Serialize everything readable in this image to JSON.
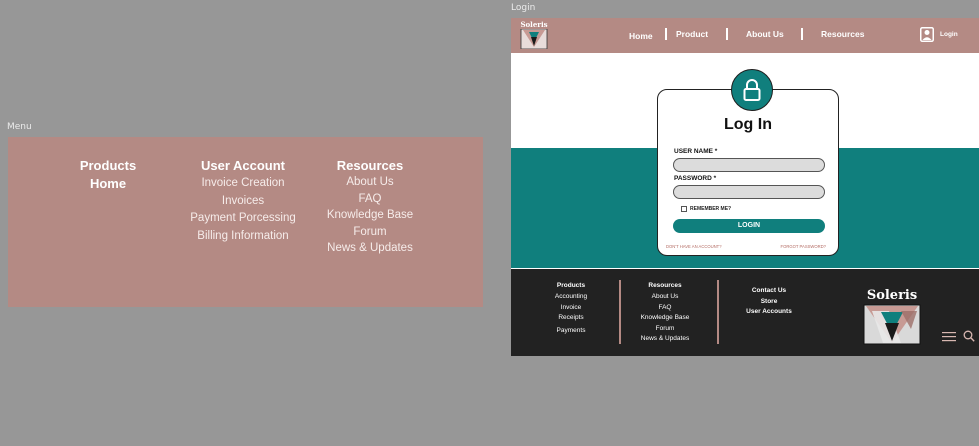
{
  "frames": {
    "menu_label": "Menu",
    "login_label": "Login"
  },
  "menu": {
    "products": {
      "title": "Products",
      "items": [
        "Home"
      ]
    },
    "user_account": {
      "title": "User Account",
      "items": [
        "Invoice Creation",
        "Invoices",
        "Payment Porcessing",
        "Billing Information"
      ]
    },
    "resources": {
      "title": "Resources",
      "items": [
        "About Us",
        "FAQ",
        "Knowledge Base",
        "Forum",
        "News & Updates"
      ]
    }
  },
  "header": {
    "logo_text": "Soleris",
    "nav": [
      "Home",
      "Product",
      "About Us",
      "Resources"
    ],
    "login_label": "Login",
    "user_icon": "user-icon"
  },
  "login_card": {
    "title": "Log In",
    "username_label": "USER NAME *",
    "password_label": "PASSWORD *",
    "username_value": "",
    "password_value": "",
    "remember_label": "REMEMBER ME?",
    "remember_checked": false,
    "button_label": "LOGIN",
    "no_account_link": "DON'T HAVE AN ACCOUNT?",
    "forgot_link": "FORGOT PASSWORD?",
    "lock_icon": "lock-icon"
  },
  "footer": {
    "products": {
      "title": "Products",
      "items": [
        "Accounting",
        "Invoice",
        "Receipts",
        "Payments"
      ]
    },
    "resources": {
      "title": "Resources",
      "items": [
        "About Us",
        "FAQ",
        "Knowledge Base",
        "Forum",
        "News & Updates"
      ]
    },
    "contact": {
      "items": [
        "Contact Us",
        "Store",
        "User Accounts"
      ]
    },
    "logo_text": "Soleris",
    "menu_icon": "hamburger-menu-icon",
    "search_icon": "search-icon"
  },
  "colors": {
    "canvas": "#979797",
    "rose": "#b48a84",
    "teal": "#107f7d",
    "footer": "#222222",
    "white": "#ffffff"
  }
}
